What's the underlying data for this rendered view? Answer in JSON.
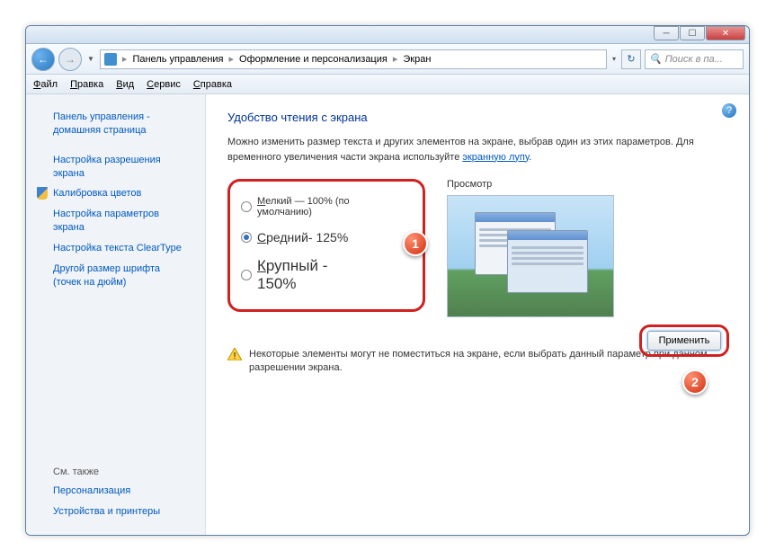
{
  "breadcrumb": {
    "root": "Панель управления",
    "mid": "Оформление и персонализация",
    "leaf": "Экран"
  },
  "search": {
    "placeholder": "Поиск в па..."
  },
  "menu": {
    "file": "айл",
    "edit": "равка",
    "view": "ид",
    "tools": "ервис",
    "help": "правка"
  },
  "sidebar": {
    "home": "Панель управления - домашняя страница",
    "resolution": "Настройка разрешения экрана",
    "calibrate": "Калибровка цветов",
    "params": "Настройка параметров экрана",
    "cleartype": "Настройка текста ClearType",
    "dpi": "Другой размер шрифта (точек на дюйм)",
    "seealso": "См. также",
    "personalization": "Персонализация",
    "devices": "Устройства и принтеры"
  },
  "main": {
    "title": "Удобство чтения с экрана",
    "intro1": "Можно изменить размер текста и других элементов на экране, выбрав один из этих параметров. Для временного увеличения части экрана используйте ",
    "magnifier": "экранную лупу",
    "opt_small": "елкий — 100% (по умолчанию)",
    "opt_medium": "редний- 125%",
    "opt_large": "рупный - 150%",
    "preview_label": "Просмотр",
    "warning": "Некоторые элементы могут не поместиться на экране, если выбрать данный параметр при данном разрешении экрана.",
    "apply": "Применить"
  },
  "badges": {
    "one": "1",
    "two": "2"
  }
}
